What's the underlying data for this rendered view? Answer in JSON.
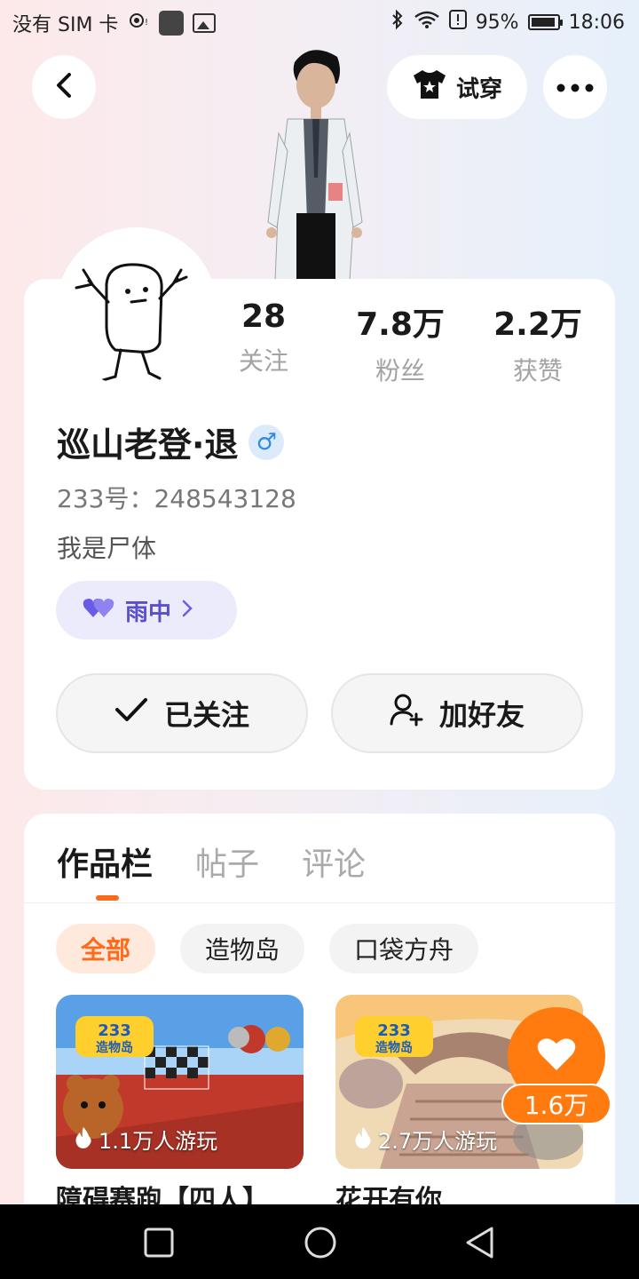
{
  "status_bar": {
    "carrier": "没有 SIM 卡",
    "battery": "95%",
    "battery_level": 0.95,
    "time": "18:06"
  },
  "header": {
    "try_on_label": "试穿"
  },
  "profile": {
    "stats": [
      {
        "value": "28",
        "label": "关注"
      },
      {
        "value": "7.8万",
        "label": "粉丝"
      },
      {
        "value": "2.2万",
        "label": "获赞"
      }
    ],
    "name": "巡山老登·退",
    "gender_symbol": "♂",
    "uid": "233号：248543128",
    "bio": "我是尸体",
    "tag_label": "雨中",
    "follow_label": "已关注",
    "add_friend_label": "加好友"
  },
  "works": {
    "tabs": [
      "作品栏",
      "帖子",
      "评论"
    ],
    "filters": [
      "全部",
      "造物岛",
      "口袋方舟"
    ],
    "games": [
      {
        "plays": "1.1万人游玩",
        "title": "障碍赛跑【四人】"
      },
      {
        "plays": "2.7万人游玩",
        "title": "花开有你"
      }
    ],
    "like_count": "1.6万"
  },
  "colors": {
    "accent": "#ff6a1a",
    "tag_purple": "#5a4ec9",
    "gender_blue": "#2e8ae6"
  }
}
